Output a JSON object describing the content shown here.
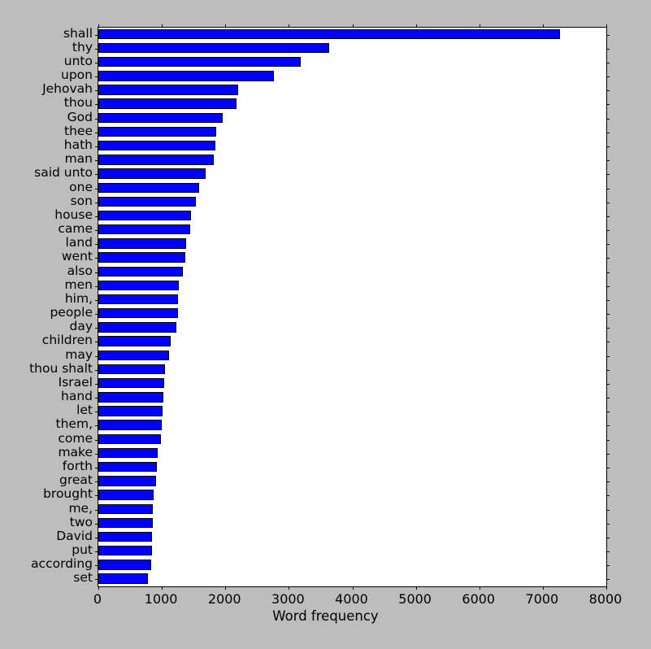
{
  "chart_data": {
    "type": "bar",
    "orientation": "horizontal",
    "title": "",
    "xlabel": "Word frequency",
    "ylabel": "",
    "xlim": [
      0,
      8000
    ],
    "xticks": [
      0,
      1000,
      2000,
      3000,
      4000,
      5000,
      6000,
      7000,
      8000
    ],
    "xticklabels": [
      "0",
      "1000",
      "2000",
      "3000",
      "4000",
      "5000",
      "6000",
      "7000",
      "8000"
    ],
    "grid": false,
    "legend": null,
    "bar_color": "#0000ff",
    "bar_edge_color": "#000000",
    "figure_facecolor": "#bdbdbd",
    "axes_facecolor": "#ffffff",
    "categories": [
      "shall",
      "thy",
      "unto",
      "upon",
      "Jehovah",
      "thou",
      "God",
      "thee",
      "hath",
      "man",
      "said unto",
      "one",
      "son",
      "house",
      "came",
      "land",
      "went",
      "also",
      "men",
      "him,",
      "people",
      "day",
      "children",
      "may",
      "thou shalt",
      "Israel",
      "hand",
      "let",
      "them,",
      "come",
      "make",
      "forth",
      "great",
      "brought",
      "me,",
      "two",
      "David",
      "put",
      "according",
      "set"
    ],
    "values": [
      7270,
      3630,
      3190,
      2770,
      2200,
      2170,
      1955,
      1850,
      1845,
      1820,
      1690,
      1585,
      1530,
      1465,
      1440,
      1380,
      1370,
      1330,
      1265,
      1260,
      1255,
      1225,
      1135,
      1110,
      1045,
      1035,
      1030,
      1010,
      1000,
      985,
      935,
      920,
      905,
      870,
      855,
      855,
      845,
      840,
      830,
      780
    ]
  }
}
